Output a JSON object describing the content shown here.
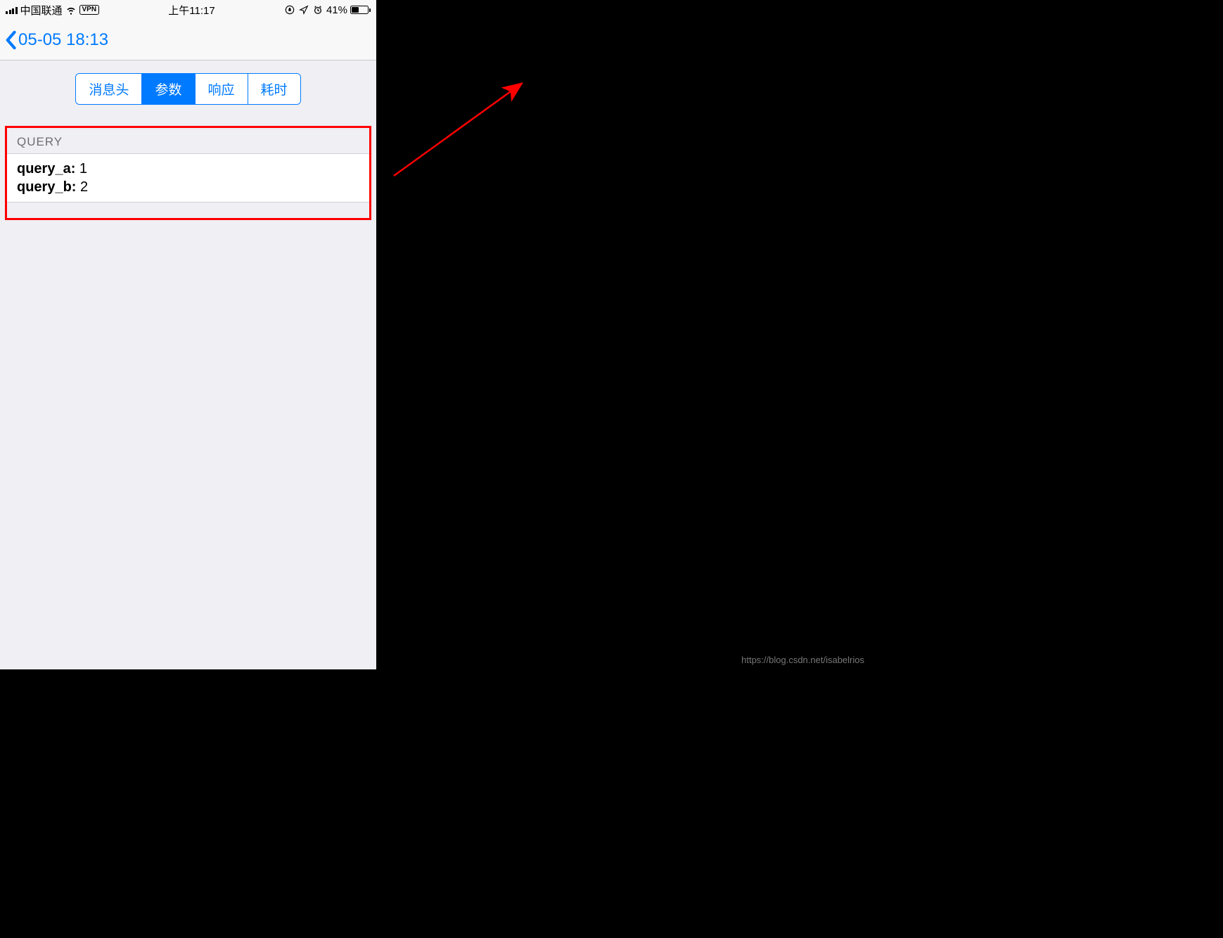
{
  "status_bar": {
    "carrier": "中国联通",
    "vpn_label": "VPN",
    "time": "上午11:17",
    "battery_percent": "41%"
  },
  "nav": {
    "back_title": "05-05 18:13"
  },
  "tabs": {
    "t0": "消息头",
    "t1": "参数",
    "t2": "响应",
    "t3": "耗时",
    "active_index": 1
  },
  "query_section": {
    "header": "QUERY",
    "rows": [
      {
        "key": "query_a:",
        "value": " 1"
      },
      {
        "key": "query_b:",
        "value": " 2"
      }
    ]
  },
  "watermark": "https://blog.csdn.net/isabelrios"
}
